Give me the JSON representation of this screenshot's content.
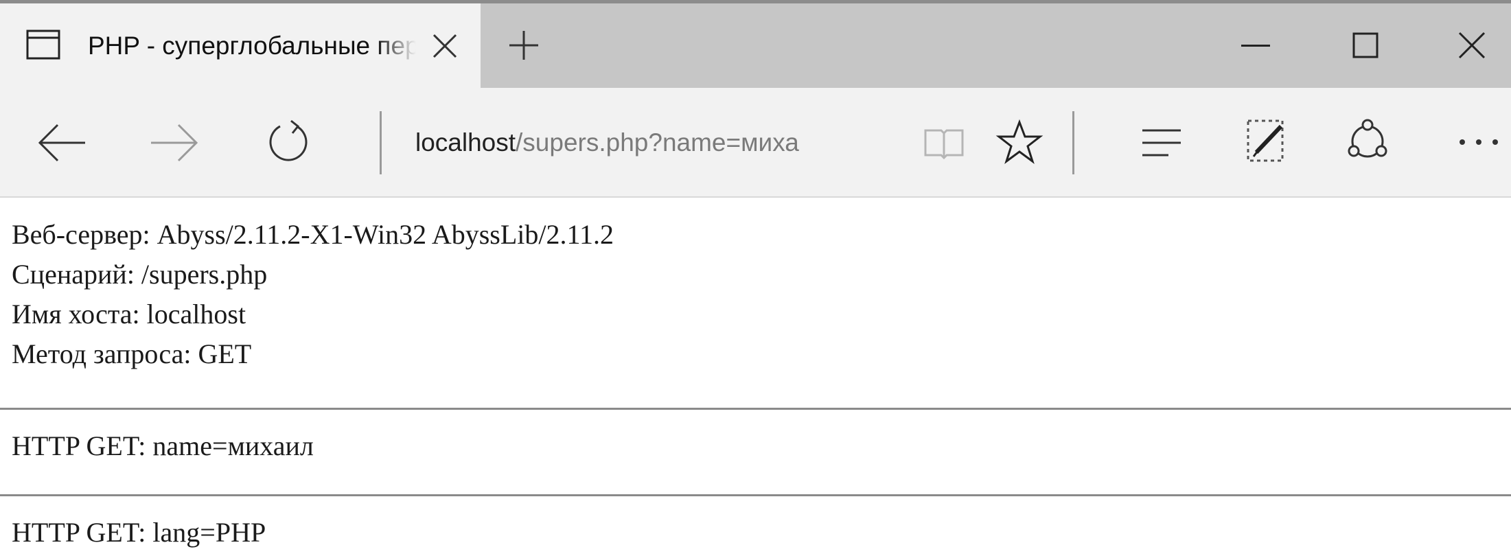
{
  "tab": {
    "title": "PHP - суперглобальные переменные",
    "icon": "page-icon",
    "close_icon": "close-icon"
  },
  "tabbar": {
    "new_tab_icon": "plus-icon"
  },
  "window_controls": {
    "minimize_icon": "minimize-icon",
    "maximize_icon": "maximize-icon",
    "close_icon": "close-icon"
  },
  "navigation": {
    "back_icon": "arrow-left-icon",
    "forward_icon": "arrow-right-icon",
    "refresh_icon": "refresh-icon"
  },
  "address_bar": {
    "host": "localhost",
    "path": "/supers.php?name=миха"
  },
  "toolbar": {
    "reading_view_icon": "book-icon",
    "favorite_icon": "star-icon",
    "hub_icon": "hub-lines-icon",
    "web_note_icon": "pen-note-icon",
    "share_icon": "share-icon",
    "more_icon": "more-dots-icon"
  },
  "page": {
    "server_line": "Веб-сервер: Abyss/2.11.2-X1-Win32 AbyssLib/2.11.2",
    "script_line": "Сценарий: /supers.php",
    "host_line": "Имя хоста: localhost",
    "method_line": "Метод запроса: GET",
    "get_lines": [
      "HTTP GET: name=михаил",
      "HTTP GET: lang=PHP"
    ]
  },
  "colors": {
    "tab_active_bg": "#f2f2f2",
    "tabbar_bg": "#c6c6c6",
    "address_path": "#7a7a7a",
    "page_text": "#1a1a1a",
    "rule": "#8a8a8a"
  }
}
